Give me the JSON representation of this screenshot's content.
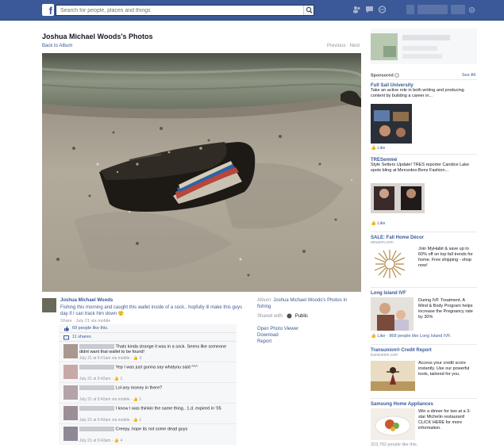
{
  "topbar": {
    "logo": "f",
    "search_placeholder": "Search for people, places and things"
  },
  "photo_page": {
    "title": "Joshua Michael Woods's Photos",
    "back_link": "Back to Album",
    "pager": "Previous · Next"
  },
  "post": {
    "author": "Joshua Michael Woods",
    "caption": "Fishing this morning and caught this wallet inside of a sock.. hopfully ill make this guys day if I can track him down 🙂",
    "meta": "Share · July 21 via mobile",
    "likes": "69 people like this.",
    "shares": "11 shares"
  },
  "side_info": {
    "album_label": "Album:",
    "album_name": "Joshua Michael Woods's Photos in fishing",
    "shared_with_label": "Shared with:",
    "shared_with_value": "Public",
    "actions": [
      "Open Photo Viewer",
      "Download",
      "Report"
    ]
  },
  "comments": [
    {
      "text": "Thats kinda strange it was in a sock. Seens like someone didnt want that wallet to be found!",
      "meta": "July 21 at 9:41am via mobile · 👍 3"
    },
    {
      "text": "Yep I was just gunna say whatyou said ^^^",
      "meta": "July 21 at 9:42am · 👍 1"
    },
    {
      "text": "Lol any money in there?",
      "meta": "July 21 at 9:42am via mobile · 👍 1"
    },
    {
      "text": "I know I was thinkin the same thing.. 1.d. expired in '05",
      "meta": "July 21 at 9:43am via mobile · 👍 1"
    },
    {
      "text": "Creepy..hope its not some dead guys",
      "meta": "July 21 at 9:43am · 👍 4"
    }
  ],
  "sidebar": {
    "sponsored_label": "Sponsored",
    "see_all": "See All",
    "ads": [
      {
        "title": "Full Sail University",
        "text": "Take an active role in both writing and producing content by building a career in...",
        "like": "Like"
      },
      {
        "title": "TRESemmé",
        "text": "Style Setters Update! TRES reporter Candice Lake spots bling at Mercedes-Benz Fashion...",
        "like": "Like"
      },
      {
        "title": "SALE: Fall Home Décor",
        "host": "amazon.com",
        "text": "Join MyHabit & save up to 60% off on top fall trends for home. Free shipping - shop now!"
      },
      {
        "title": "Long Island IVF",
        "text": "During IVF Treatment, A Mind & Body Program helps increase the Pregnancy rate by 30%",
        "like": "Like · 868 people like Long Island IVF."
      },
      {
        "title": "Transunion® Credit Report",
        "host": "transunion.com",
        "text": "Access your credit score instantly. Use our powerful tools, tailored for you."
      },
      {
        "title": "Samsung Home Appliances",
        "text": "Win a dinner for two at a 3-star Michelin restaurant! CLICK HERE for more information.",
        "like": "323,782 people like this."
      }
    ]
  },
  "colors": {
    "brand": "#3b5998",
    "link": "#3b5998",
    "muted": "#90949c"
  }
}
